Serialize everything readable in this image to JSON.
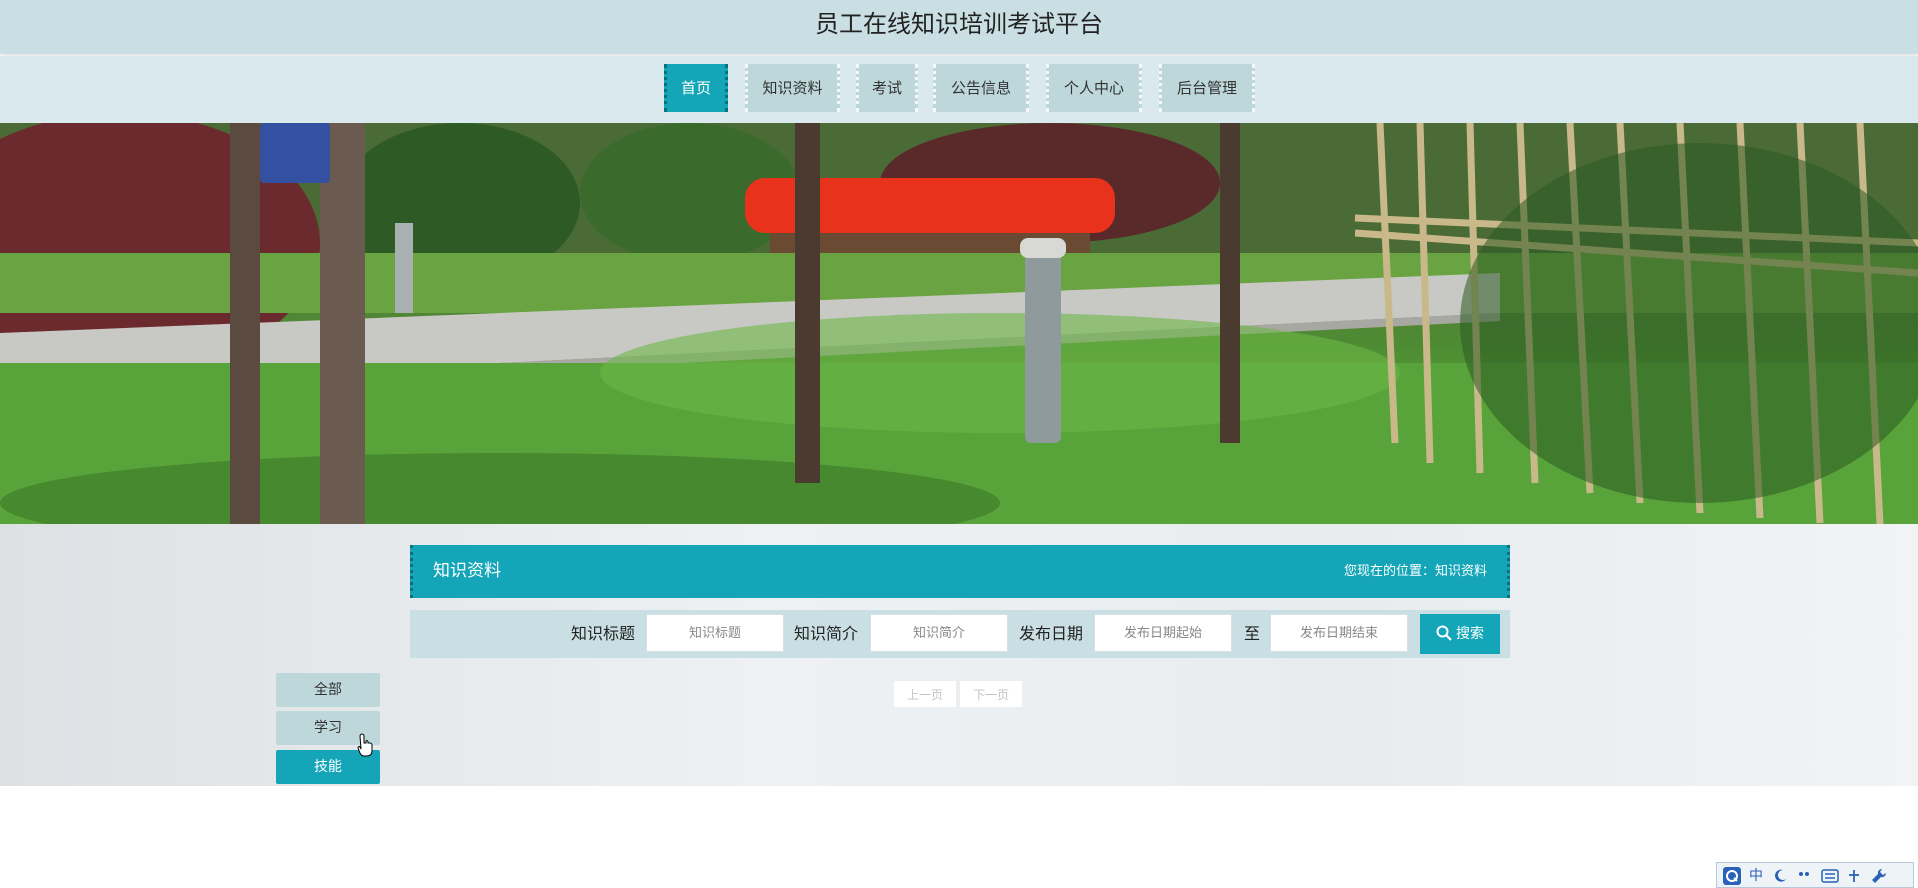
{
  "header": {
    "site_title": "员工在线知识培训考试平台"
  },
  "nav": [
    {
      "label": "首页",
      "active": true
    },
    {
      "label": "知识资料",
      "active": false
    },
    {
      "label": "考试",
      "active": false
    },
    {
      "label": "公告信息",
      "active": false
    },
    {
      "label": "个人中心",
      "active": false
    },
    {
      "label": "后台管理",
      "active": false
    }
  ],
  "section": {
    "title": "知识资料",
    "breadcrumb_prefix": "您现在的位置：",
    "breadcrumb_current": "知识资料"
  },
  "search": {
    "title_label": "知识标题",
    "title_placeholder": "知识标题",
    "intro_label": "知识简介",
    "intro_placeholder": "知识简介",
    "date_label": "发布日期",
    "date_start_placeholder": "发布日期起始",
    "to_label": "至",
    "date_end_placeholder": "发布日期结束",
    "button_label": "搜索"
  },
  "pager": {
    "prev_label": "上一页",
    "next_label": "下一页"
  },
  "categories": [
    {
      "label": "全部",
      "active": false
    },
    {
      "label": "学习",
      "active": false
    },
    {
      "label": "技能",
      "active": true
    }
  ],
  "ime": {
    "mode_label": "中"
  },
  "colors": {
    "accent": "#14a6b8",
    "nav_bg": "#bdd7da",
    "header_bg": "#c9dfe3"
  }
}
